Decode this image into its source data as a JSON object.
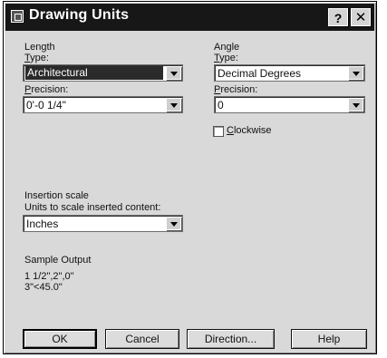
{
  "window": {
    "title": "Drawing Units",
    "help_glyph": "?",
    "close_glyph": "✕"
  },
  "length": {
    "group_label": "Length",
    "type_label": "Type:",
    "type_value": "Architectural",
    "precision_label": "Precision:",
    "precision_value": "0'-0 1/4\""
  },
  "angle": {
    "group_label": "Angle",
    "type_label": "Type:",
    "type_value": "Decimal Degrees",
    "precision_label": "Precision:",
    "precision_value": "0",
    "clockwise_label": "Clockwise",
    "clockwise_checked": false
  },
  "insertion": {
    "group_label": "Insertion scale",
    "prompt": "Units to scale inserted content:",
    "value": "Inches"
  },
  "sample": {
    "group_label": "Sample Output",
    "line1": "1 1/2\",2\",0\"",
    "line2": "3\"<45.0\""
  },
  "buttons": {
    "ok": "OK",
    "cancel": "Cancel",
    "direction": "Direction...",
    "help": "Help"
  },
  "icons": {
    "title": "drawing-units-app-icon",
    "dropdown": "chevron-down-icon"
  }
}
